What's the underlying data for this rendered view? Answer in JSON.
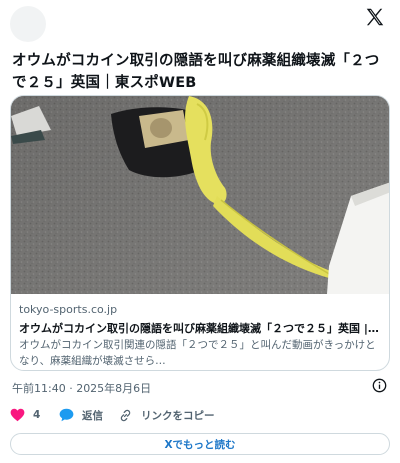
{
  "tweet": {
    "text": "オウムがコカイン取引の隠語を叫び麻薬組織壊滅「２つで２５」英国｜東スポWEB"
  },
  "card": {
    "domain": "tokyo-sports.co.jp",
    "title": "オウムがコカイン取引の隠語を叫び麻薬組織壊滅「２つで２５」英国 | 東ス…",
    "description": "オウムがコカイン取引関連の隠語「２つで２５」と叫んだ動画がきっかけとなり、麻薬組織が壊滅させら…"
  },
  "meta": {
    "timestamp": "午前11:40 · 2025年8月6日"
  },
  "actions": {
    "like_count": "4",
    "reply_label": "返信",
    "copy_label": "リンクをコピー"
  },
  "read_more": "Xでもっと読む",
  "colors": {
    "like": "#f91880",
    "reply": "#1d9bf0",
    "link": "#1d77c8",
    "muted": "#536471"
  },
  "icons": [
    "x-logo-icon",
    "info-icon",
    "heart-icon",
    "speech-bubble-icon",
    "link-icon"
  ]
}
